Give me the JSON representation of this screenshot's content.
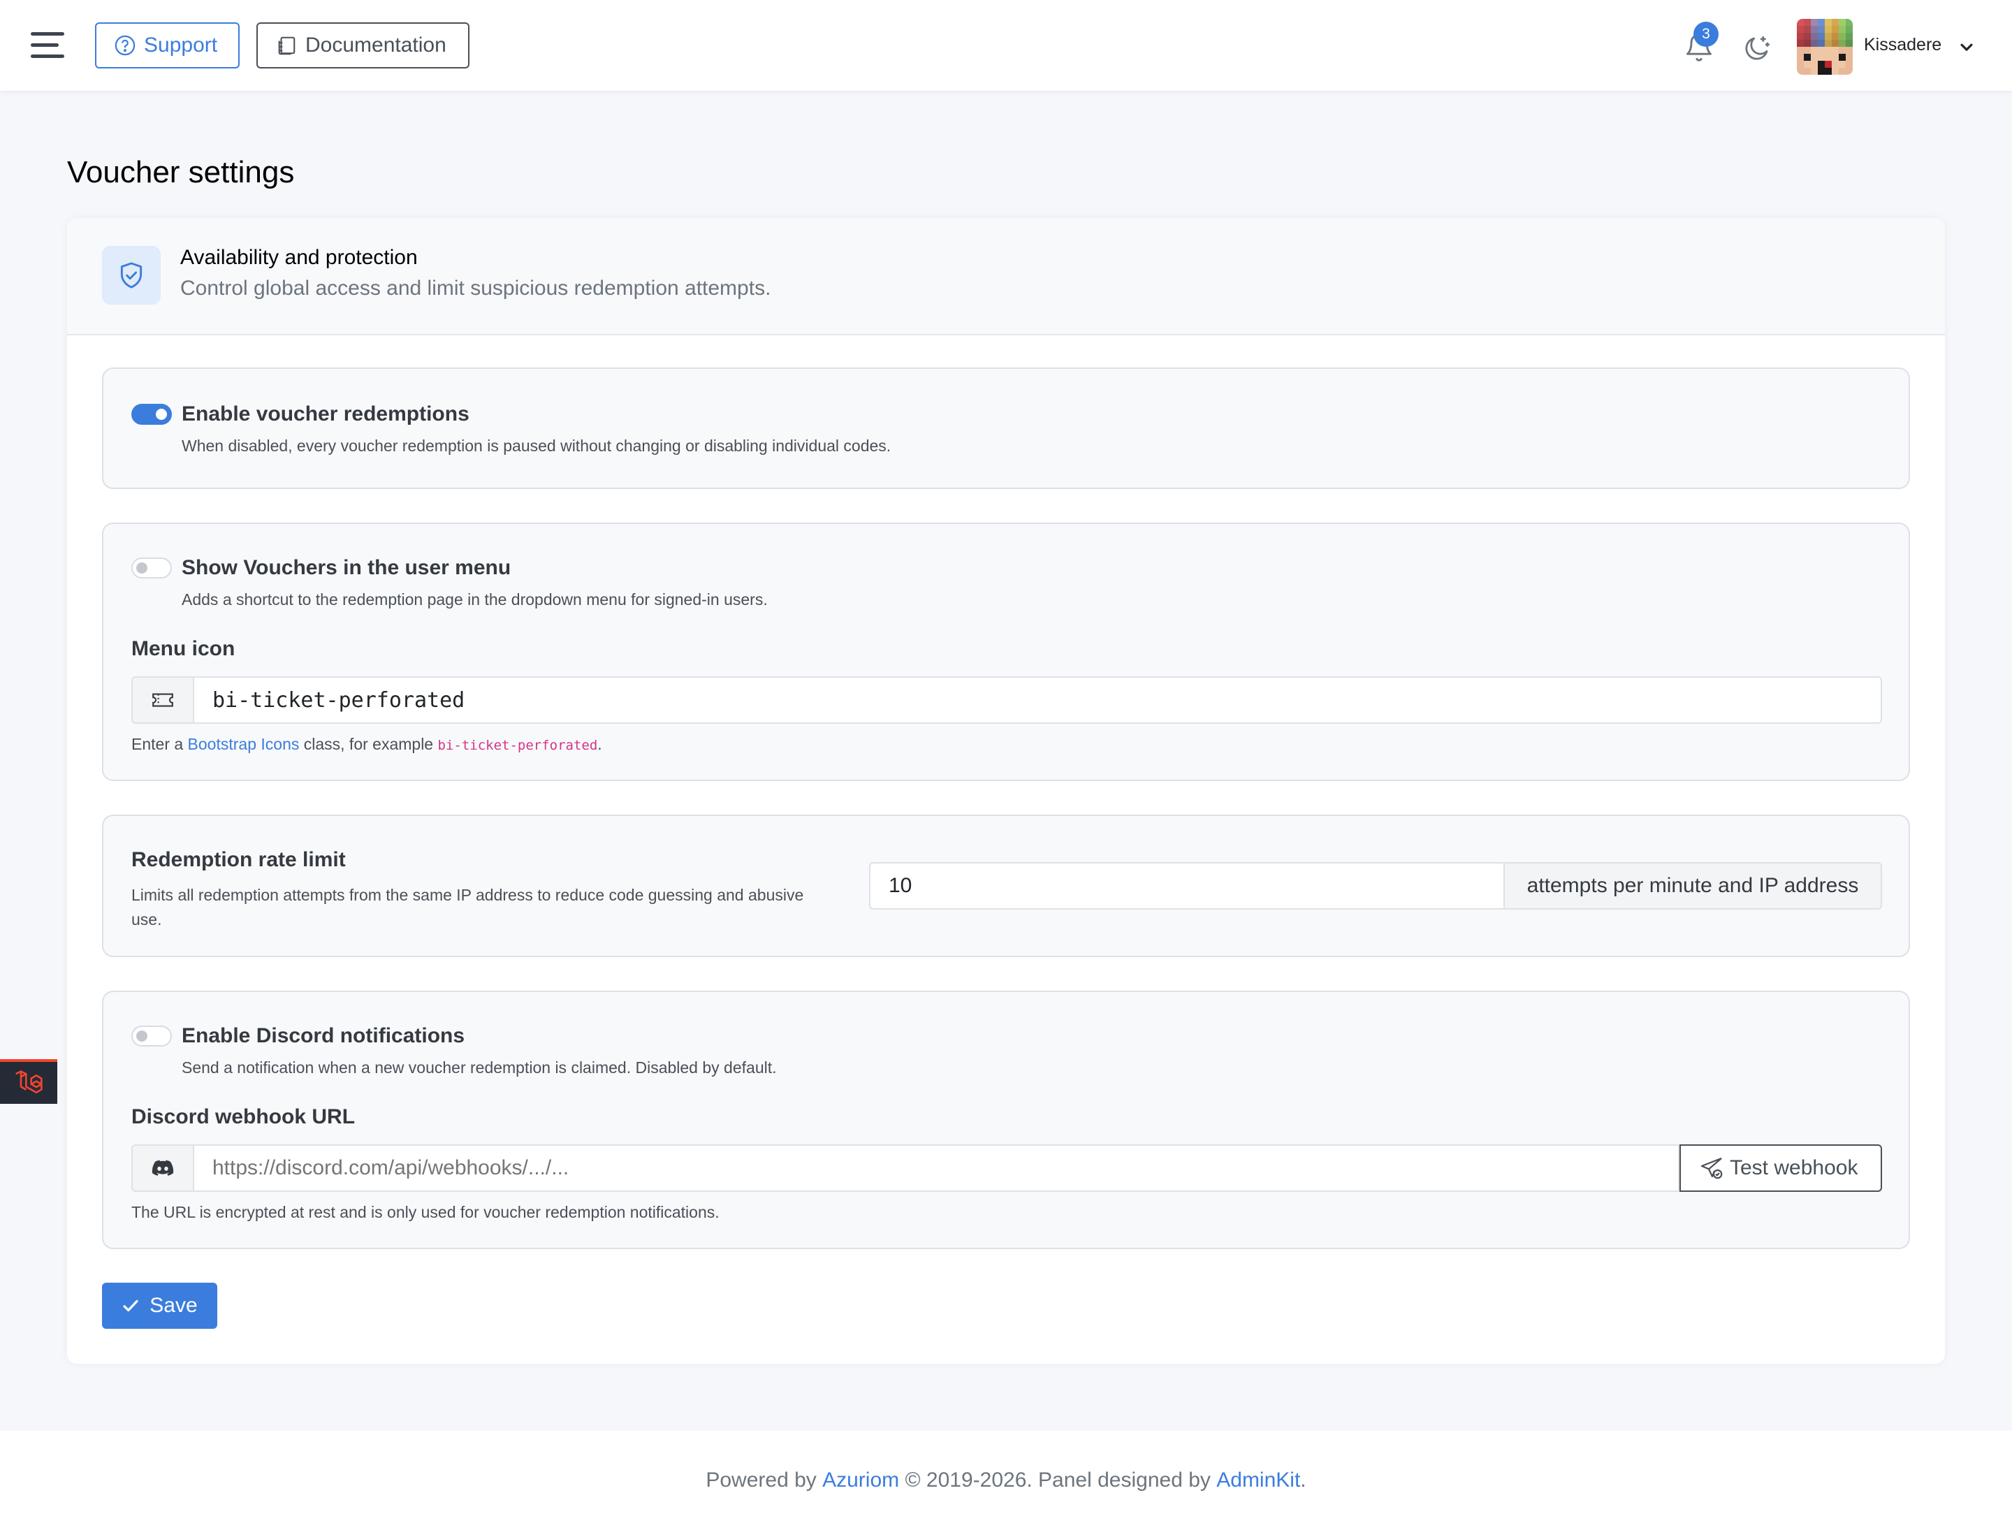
{
  "navbar": {
    "support_label": "Support",
    "docs_label": "Documentation",
    "notification_count": "3",
    "username": "Kissadere"
  },
  "page": {
    "title": "Voucher settings"
  },
  "card": {
    "header_title": "Availability and protection",
    "header_subtitle": "Control global access and limit suspicious redemption attempts."
  },
  "redemptions": {
    "enabled": true,
    "label": "Enable voucher redemptions",
    "help": "When disabled, every voucher redemption is paused without changing or disabling individual codes."
  },
  "user_menu": {
    "enabled": false,
    "label": "Show Vouchers in the user menu",
    "help": "Adds a shortcut to the redemption page in the dropdown menu for signed-in users.",
    "icon_label": "Menu icon",
    "icon_value": "bi-ticket-perforated",
    "icon_help_prefix": "Enter a ",
    "icon_help_link": "Bootstrap Icons",
    "icon_help_middle": " class, for example ",
    "icon_help_code": "bi-ticket-perforated",
    "icon_help_suffix": "."
  },
  "rate_limit": {
    "label": "Redemption rate limit",
    "help": "Limits all redemption attempts from the same IP address to reduce code guessing and abusive use.",
    "value": "10",
    "suffix": "attempts per minute and IP address"
  },
  "discord": {
    "enabled": false,
    "label": "Enable Discord notifications",
    "help": "Send a notification when a new voucher redemption is claimed. Disabled by default.",
    "webhook_label": "Discord webhook URL",
    "webhook_placeholder": "https://discord.com/api/webhooks/.../...",
    "test_label": "Test webhook",
    "webhook_help": "The URL is encrypted at rest and is only used for voucher redemption notifications."
  },
  "save_label": "Save",
  "footer": {
    "prefix": "Powered by ",
    "azuriom": "Azuriom",
    "middle": " © 2019-2026. Panel designed by ",
    "adminkit": "AdminKit",
    "suffix": "."
  },
  "colors": {
    "primary": "#3b7ddd",
    "background": "#f5f7fb",
    "code_pink": "#d63384"
  }
}
